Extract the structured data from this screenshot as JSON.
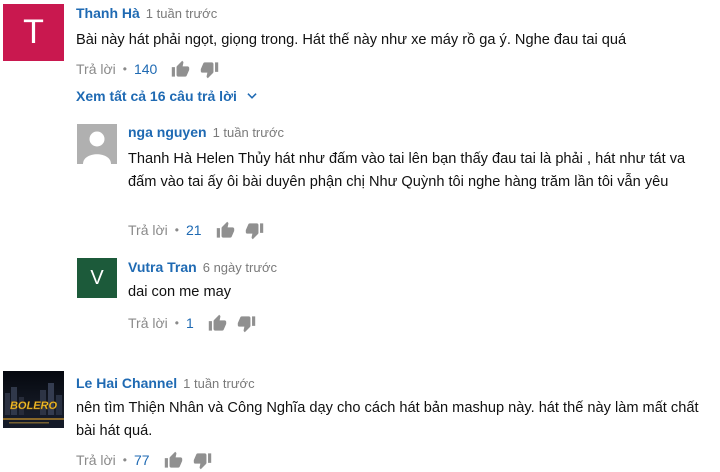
{
  "colors": {
    "link": "#1f6ab3",
    "meta": "#7a7a7a",
    "avatar_T": "#c9184f",
    "avatar_V": "#1c5a3a"
  },
  "comments": [
    {
      "author": "Thanh Hà",
      "time": "1 tuần trước",
      "avatar_letter": "T",
      "text": "Bài này hát phải ngọt, giọng trong. Hát thế này như xe máy rồ ga ý. Nghe đau tai quá",
      "reply_label": "Trả lời",
      "separator": "•",
      "likes": "140",
      "view_replies": "Xem tất cả 16 câu trả lời"
    },
    {
      "author": "Le Hai Channel",
      "time": "1 tuần trước",
      "avatar_text": "BOLERO",
      "text": "nên tìm Thiện Nhân và Công Nghĩa dạy cho cách hát bản mashup này.  hát thế này làm mất chất bài hát quá.",
      "reply_label": "Trả lời",
      "separator": "•",
      "likes": "77"
    }
  ],
  "replies": [
    {
      "author": "nga nguyen",
      "time": "1 tuần trước",
      "avatar_icon": "default-user-icon",
      "text": "Thanh Hà Helen Thủy hát như đấm vào tai lên bạn thấy đau tai là phải , hát như tát va đấm vào tai ấy ôi bài duyên phận chị Như Quỳnh tôi nghe hàng trăm lần tôi vẫn yêu",
      "reply_label": "Trả lời",
      "separator": "•",
      "likes": "21"
    },
    {
      "author": "Vutra Tran",
      "time": "6 ngày trước",
      "avatar_letter": "V",
      "text": "dai con me may",
      "reply_label": "Trả lời",
      "separator": "•",
      "likes": "1"
    }
  ]
}
